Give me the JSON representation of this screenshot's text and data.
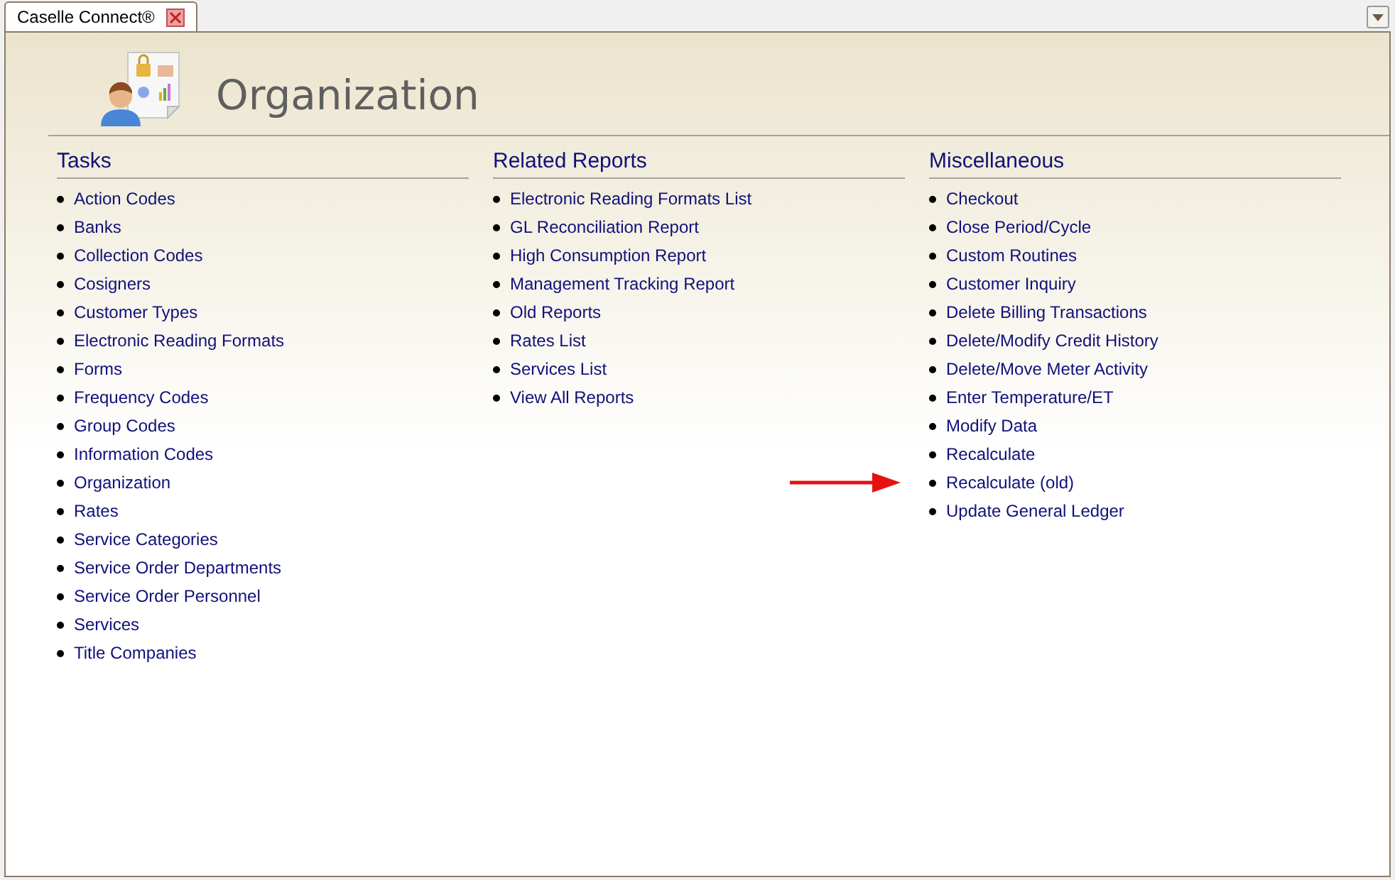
{
  "tab": {
    "title": "Caselle Connect®",
    "selected": true
  },
  "page": {
    "title": "Organization"
  },
  "columns": [
    {
      "heading": "Tasks",
      "items": [
        {
          "label": "Action Codes",
          "marked": false
        },
        {
          "label": "Banks",
          "marked": false
        },
        {
          "label": "Collection Codes",
          "marked": false
        },
        {
          "label": "Cosigners",
          "marked": false
        },
        {
          "label": "Customer Types",
          "marked": false
        },
        {
          "label": "Electronic Reading Formats",
          "marked": false
        },
        {
          "label": "Forms",
          "marked": false
        },
        {
          "label": "Frequency Codes",
          "marked": false
        },
        {
          "label": "Group Codes",
          "marked": false
        },
        {
          "label": "Information Codes",
          "marked": false
        },
        {
          "label": "Organization",
          "marked": false
        },
        {
          "label": "Rates",
          "marked": false
        },
        {
          "label": "Service Categories",
          "marked": false
        },
        {
          "label": "Service Order Departments",
          "marked": false
        },
        {
          "label": "Service Order Personnel",
          "marked": false
        },
        {
          "label": "Services",
          "marked": false
        },
        {
          "label": "Title Companies",
          "marked": false
        }
      ]
    },
    {
      "heading": "Related Reports",
      "items": [
        {
          "label": "Electronic Reading Formats List",
          "marked": false
        },
        {
          "label": "GL Reconciliation Report",
          "marked": false
        },
        {
          "label": "High Consumption Report",
          "marked": false
        },
        {
          "label": "Management Tracking Report",
          "marked": false
        },
        {
          "label": "Old Reports",
          "marked": false
        },
        {
          "label": "Rates List",
          "marked": false
        },
        {
          "label": "Services List",
          "marked": false
        },
        {
          "label": "View All Reports",
          "marked": false
        }
      ]
    },
    {
      "heading": "Miscellaneous",
      "items": [
        {
          "label": "Checkout",
          "marked": false
        },
        {
          "label": "Close Period/Cycle",
          "marked": false
        },
        {
          "label": "Custom Routines",
          "marked": false
        },
        {
          "label": "Customer Inquiry",
          "marked": false
        },
        {
          "label": "Delete Billing Transactions",
          "marked": false
        },
        {
          "label": "Delete/Modify Credit History",
          "marked": false
        },
        {
          "label": "Delete/Move Meter Activity",
          "marked": false
        },
        {
          "label": "Enter Temperature/ET",
          "marked": false
        },
        {
          "label": "Modify Data",
          "marked": false
        },
        {
          "label": "Recalculate",
          "marked": false
        },
        {
          "label": "Recalculate (old)",
          "marked": true
        },
        {
          "label": "Update General Ledger",
          "marked": false
        }
      ]
    }
  ]
}
